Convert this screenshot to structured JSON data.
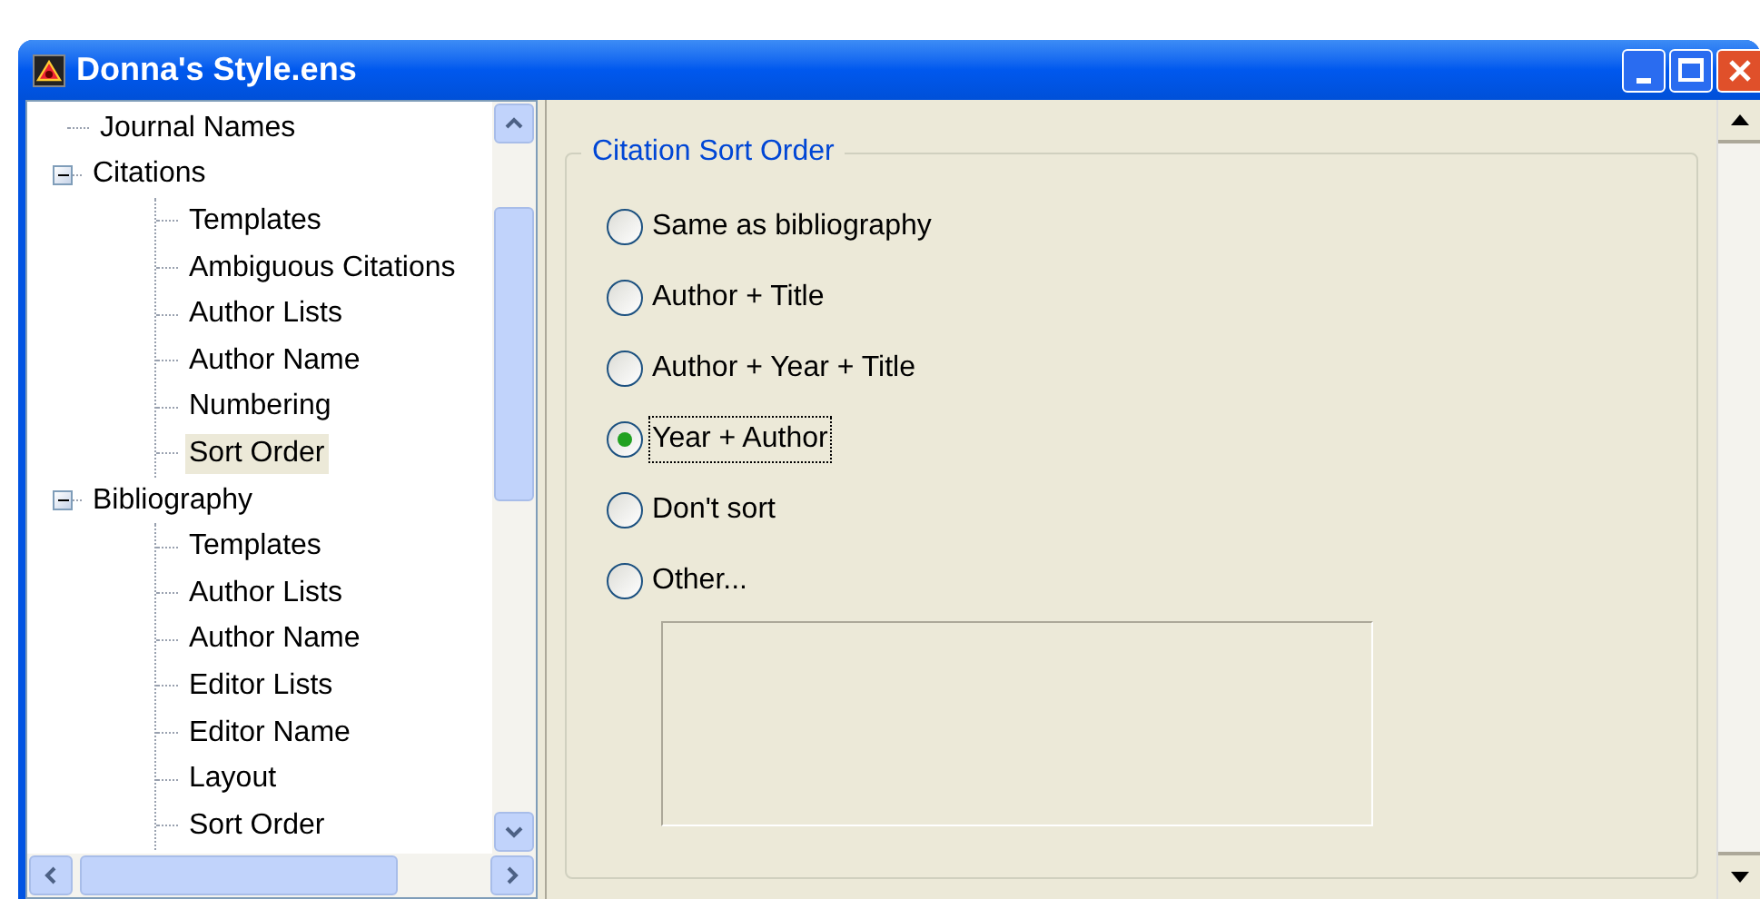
{
  "window": {
    "title": "Donna's Style.ens"
  },
  "tree": [
    {
      "label": "Journal Names",
      "selected": false
    },
    {
      "label": "Citations",
      "expanded": true,
      "selected": false,
      "children": [
        {
          "label": "Templates",
          "selected": false
        },
        {
          "label": "Ambiguous Citations",
          "selected": false
        },
        {
          "label": "Author Lists",
          "selected": false
        },
        {
          "label": "Author Name",
          "selected": false
        },
        {
          "label": "Numbering",
          "selected": false
        },
        {
          "label": "Sort Order",
          "selected": true
        }
      ]
    },
    {
      "label": "Bibliography",
      "expanded": true,
      "selected": false,
      "children": [
        {
          "label": "Templates",
          "selected": false
        },
        {
          "label": "Author Lists",
          "selected": false
        },
        {
          "label": "Author Name",
          "selected": false
        },
        {
          "label": "Editor Lists",
          "selected": false
        },
        {
          "label": "Editor Name",
          "selected": false
        },
        {
          "label": "Layout",
          "selected": false
        },
        {
          "label": "Sort Order",
          "selected": false
        }
      ]
    }
  ],
  "group": {
    "title": "Citation Sort Order",
    "options": [
      {
        "label": "Same as bibliography",
        "selected": false
      },
      {
        "label": "Author + Title",
        "selected": false
      },
      {
        "label": "Author + Year + Title",
        "selected": false
      },
      {
        "label": "Year + Author",
        "selected": true
      },
      {
        "label": "Don't sort",
        "selected": false
      },
      {
        "label": "Other...",
        "selected": false
      }
    ]
  }
}
